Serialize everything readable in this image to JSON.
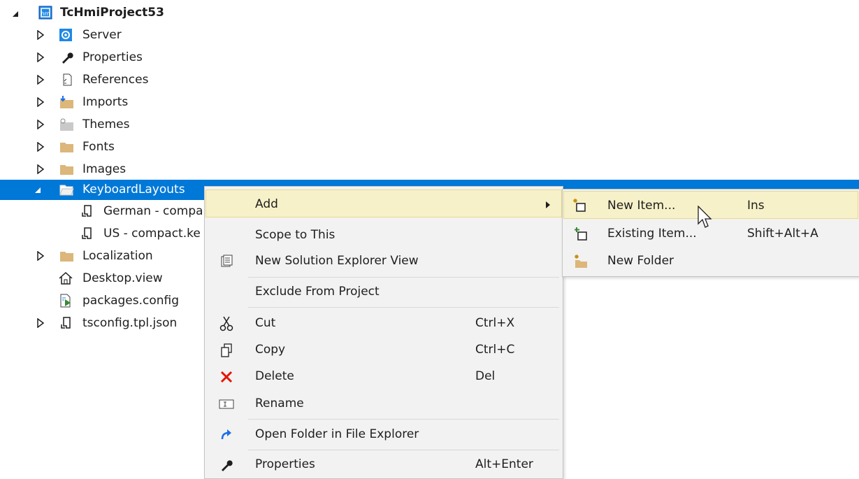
{
  "tree": {
    "root": {
      "label": "TcHmiProject53",
      "icon": "hmi-project-icon"
    },
    "items": [
      {
        "label": "Server",
        "icon": "server-gear-icon",
        "expand": "collapsed"
      },
      {
        "label": "Properties",
        "icon": "wrench-icon",
        "expand": "collapsed"
      },
      {
        "label": "References",
        "icon": "references-icon",
        "expand": "collapsed"
      },
      {
        "label": "Imports",
        "icon": "imports-folder-icon",
        "expand": "collapsed"
      },
      {
        "label": "Themes",
        "icon": "themes-folder-icon",
        "expand": "collapsed"
      },
      {
        "label": "Fonts",
        "icon": "folder-icon",
        "expand": "collapsed"
      },
      {
        "label": "Images",
        "icon": "folder-icon",
        "expand": "collapsed"
      },
      {
        "label": "KeyboardLayouts",
        "icon": "open-folder-icon",
        "expand": "expanded",
        "selected": true
      },
      {
        "label": "German - compa",
        "icon": "json-file-icon",
        "expand": "none"
      },
      {
        "label": "US - compact.ke",
        "icon": "json-file-icon",
        "expand": "none"
      },
      {
        "label": "Localization",
        "icon": "folder-icon",
        "expand": "collapsed"
      },
      {
        "label": "Desktop.view",
        "icon": "home-icon",
        "expand": "none"
      },
      {
        "label": "packages.config",
        "icon": "config-file-icon",
        "expand": "none"
      },
      {
        "label": "tsconfig.tpl.json",
        "icon": "json-file-icon",
        "expand": "collapsed"
      }
    ]
  },
  "context_menu": {
    "items": [
      {
        "label": "Add",
        "shortcut": "",
        "icon": "",
        "submenu": true,
        "highlighted": true
      },
      {
        "label": "Scope to This",
        "shortcut": "",
        "icon": ""
      },
      {
        "label": "New Solution Explorer View",
        "shortcut": "",
        "icon": "new-view-icon"
      },
      {
        "label": "Exclude From Project",
        "shortcut": "",
        "icon": ""
      },
      {
        "label": "Cut",
        "shortcut": "Ctrl+X",
        "icon": "scissors-icon"
      },
      {
        "label": "Copy",
        "shortcut": "Ctrl+C",
        "icon": "copy-icon"
      },
      {
        "label": "Delete",
        "shortcut": "Del",
        "icon": "delete-x-icon"
      },
      {
        "label": "Rename",
        "shortcut": "",
        "icon": "rename-icon"
      },
      {
        "label": "Open Folder in File Explorer",
        "shortcut": "",
        "icon": "open-folder-arrow-icon"
      },
      {
        "label": "Properties",
        "shortcut": "Alt+Enter",
        "icon": "wrench-icon"
      }
    ]
  },
  "submenu": {
    "items": [
      {
        "label": "New Item...",
        "shortcut": "Ins",
        "icon": "new-item-icon",
        "highlighted": true
      },
      {
        "label": "Existing Item...",
        "shortcut": "Shift+Alt+A",
        "icon": "existing-item-icon"
      },
      {
        "label": "New Folder",
        "shortcut": "",
        "icon": "new-folder-icon"
      }
    ]
  },
  "colors": {
    "selection": "#0078d7",
    "menu_bg": "#f2f2f2",
    "menu_highlight": "#f7f1c9",
    "delete_red": "#e51400",
    "folder_yellow": "#dcb67a"
  }
}
